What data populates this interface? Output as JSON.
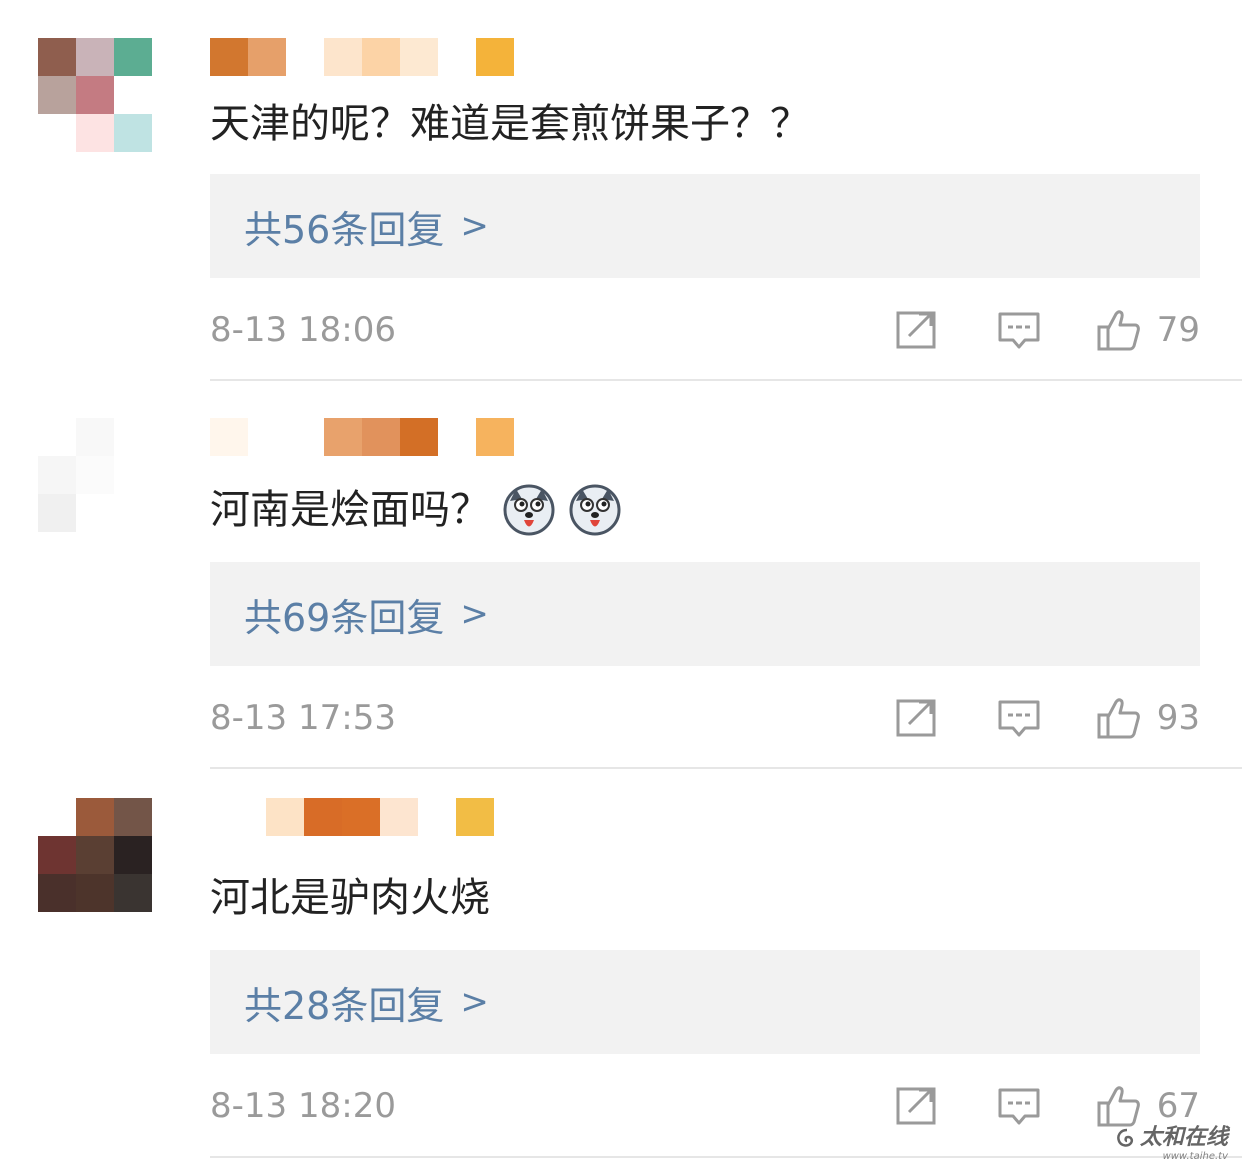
{
  "colors": {
    "reply_link": "#5b7fa6",
    "meta_text": "#9a9a9a",
    "body_text": "#222222",
    "reply_box_bg": "#f2f2f2"
  },
  "comments": [
    {
      "text": "天津的呢？难道是套煎饼果子？？",
      "replies_label": "共56条回复",
      "chevron": ">",
      "time": "8-13 18:06",
      "likes": "79",
      "avatar_colors": [
        "#8f5e4e",
        "#c9b3b8",
        "#5cad92",
        "#b8a29c",
        "#c47b82",
        "#ffffff",
        "#ffffff",
        "#fde3e3",
        "#bfe3e3"
      ],
      "username_colors": [
        "#d2772f",
        "#e6a06a",
        "gap",
        "#fde5cc",
        "#fcd3a6",
        "#fde9d2",
        "gap",
        "#f4b33a"
      ]
    },
    {
      "text": "河南是烩面吗？",
      "emoji": "husky-emoji",
      "replies_label": "共69条回复",
      "chevron": ">",
      "time": "8-13 17:53",
      "likes": "93",
      "avatar_colors": [
        "#ffffff",
        "#f8f8f8",
        "#ffffff",
        "#f6f6f6",
        "#fbfbfb",
        "#ffffff",
        "#f0f0f0",
        "#ffffff",
        "#ffffff"
      ],
      "username_colors": [
        "#fff6ec",
        "#ffffff",
        "gap",
        "#e8a26c",
        "#e1925c",
        "#d36f26",
        "gap",
        "#f6b35e"
      ]
    },
    {
      "text": "河北是驴肉火烧",
      "replies_label": "共28条回复",
      "chevron": ">",
      "time": "8-13 18:20",
      "likes": "67",
      "avatar_colors": [
        "#ffffff",
        "#9b5a3b",
        "#735548",
        "#6e3431",
        "#5a3f33",
        "#2a2222",
        "#4a302b",
        "#4d342b",
        "#3a3431"
      ],
      "username_colors": [
        "#ffffff",
        "#fde3c6",
        "#d86c27",
        "#da6f27",
        "#fde5d0",
        "gap",
        "#f2bd45"
      ]
    }
  ],
  "watermark": {
    "name": "太和在线",
    "url": "www.taihe.tv"
  }
}
